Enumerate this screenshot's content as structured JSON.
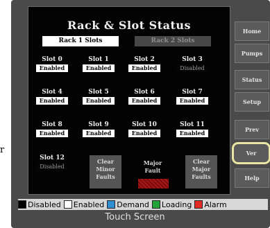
{
  "side_letter": "r",
  "title": "Rack & Slot Status",
  "tabs": [
    {
      "label": "Rack 1 Slots"
    },
    {
      "label": "Rack 2 Slots"
    }
  ],
  "slots": [
    {
      "name": "Slot 0",
      "status": "Enabled"
    },
    {
      "name": "Slot 1",
      "status": "Enabled"
    },
    {
      "name": "Slot 2",
      "status": "Enabled"
    },
    {
      "name": "Slot 3",
      "status": "Disabled"
    },
    {
      "name": "Slot 4",
      "status": "Enabled"
    },
    {
      "name": "Slot 5",
      "status": "Enabled"
    },
    {
      "name": "Slot 6",
      "status": "Enabled"
    },
    {
      "name": "Slot 7",
      "status": "Enabled"
    },
    {
      "name": "Slot 8",
      "status": "Enabled"
    },
    {
      "name": "Slot 9",
      "status": "Enabled"
    },
    {
      "name": "Slot 10",
      "status": "Enabled"
    },
    {
      "name": "Slot 11",
      "status": "Enabled"
    },
    {
      "name": "Slot 12",
      "status": "Disabled"
    }
  ],
  "actions": {
    "clear_minor": [
      "Clear",
      "Minor",
      "Faults"
    ],
    "major_fault": [
      "Major",
      "Fault"
    ],
    "clear_major": [
      "Clear",
      "Major",
      "Faults"
    ]
  },
  "nav": [
    {
      "label": "Home"
    },
    {
      "label": "Pumps"
    },
    {
      "label": "Status"
    },
    {
      "label": "Setup"
    },
    {
      "label": "Prev"
    },
    {
      "label": "Ver"
    },
    {
      "label": "Help"
    }
  ],
  "legend": [
    {
      "label": "Disabled",
      "color": "#000000"
    },
    {
      "label": "Enabled",
      "color": "#ffffff"
    },
    {
      "label": "Demand",
      "color": "#2f8fd0"
    },
    {
      "label": "Loading",
      "color": "#21a33a"
    },
    {
      "label": "Alarm",
      "color": "#e02a24"
    }
  ],
  "footer": "Touch Screen"
}
